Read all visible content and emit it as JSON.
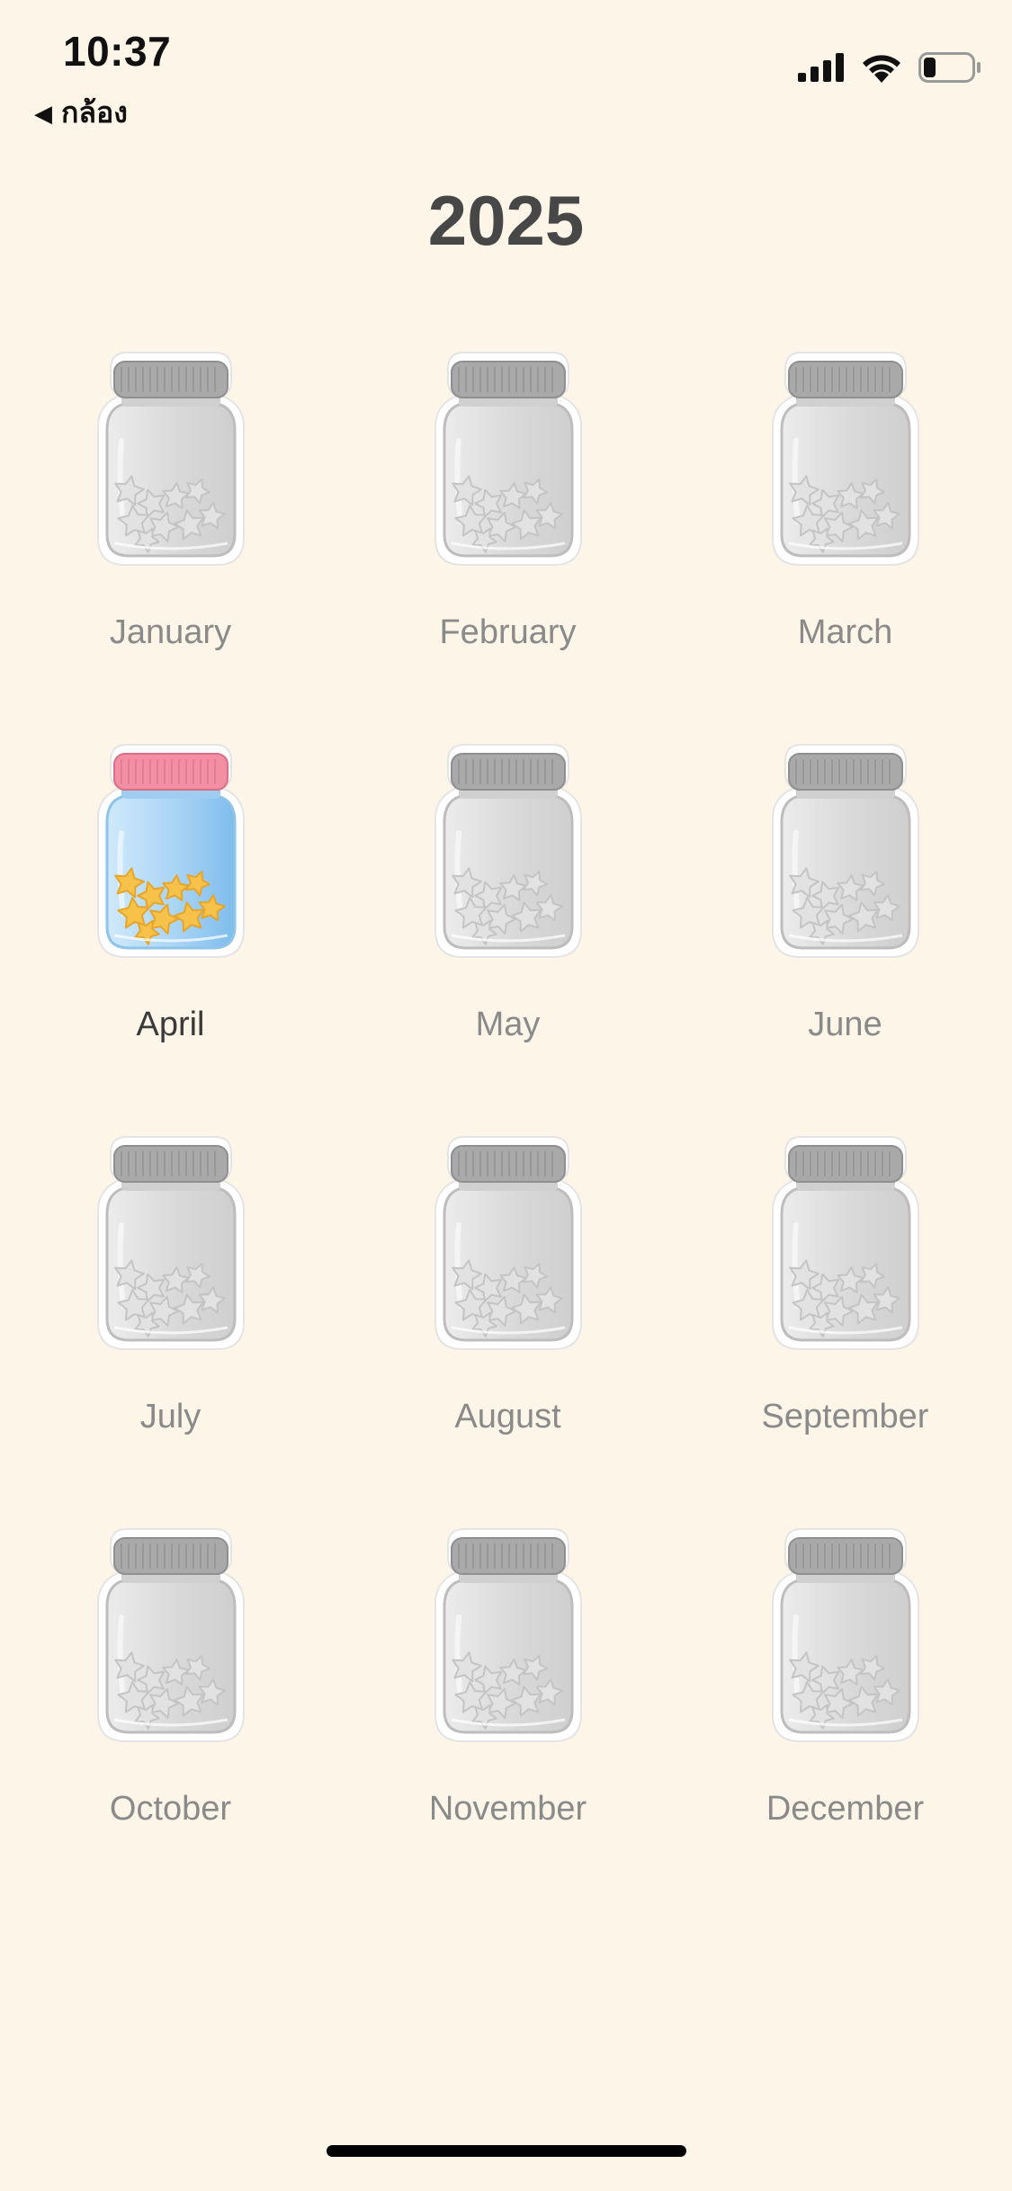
{
  "status_bar": {
    "time": "10:37",
    "back_label": "กล้อง",
    "icons": [
      "cellular-signal-icon",
      "wifi-icon",
      "battery-icon"
    ],
    "battery_level": 0.25
  },
  "year": "2025",
  "months": [
    {
      "label": "January",
      "active": false
    },
    {
      "label": "February",
      "active": false
    },
    {
      "label": "March",
      "active": false
    },
    {
      "label": "April",
      "active": true
    },
    {
      "label": "May",
      "active": false
    },
    {
      "label": "June",
      "active": false
    },
    {
      "label": "July",
      "active": false
    },
    {
      "label": "August",
      "active": false
    },
    {
      "label": "September",
      "active": false
    },
    {
      "label": "October",
      "active": false
    },
    {
      "label": "November",
      "active": false
    },
    {
      "label": "December",
      "active": false
    }
  ],
  "colors": {
    "background": "#fcf5e8",
    "active_lid": "#f28fa4",
    "active_jar": "#a8d4f5",
    "active_stars": "#f7c24a",
    "inactive_jar": "#d9d9d9"
  },
  "jar_icon": "star-jar-icon"
}
